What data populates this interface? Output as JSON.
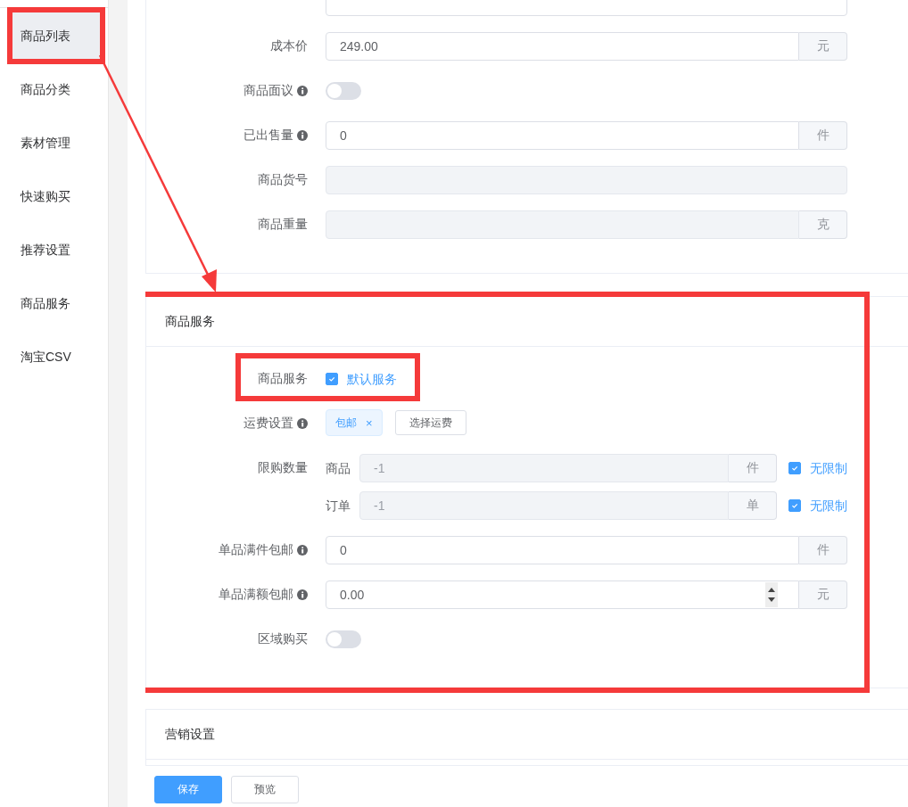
{
  "sidebar": {
    "items": [
      {
        "label": "商品列表",
        "selected": true,
        "highlighted": true
      },
      {
        "label": "商品分类",
        "selected": false,
        "highlighted": false
      },
      {
        "label": "素材管理",
        "selected": false,
        "highlighted": false
      },
      {
        "label": "快速购买",
        "selected": false,
        "highlighted": false
      },
      {
        "label": "推荐设置",
        "selected": false,
        "highlighted": false
      },
      {
        "label": "商品服务",
        "selected": false,
        "highlighted": false
      },
      {
        "label": "淘宝CSV",
        "selected": false,
        "highlighted": false
      }
    ]
  },
  "annotation_arrow": true,
  "basic_card": {
    "fields": [
      {
        "kind": "input"
      },
      {
        "kind": "input",
        "label": "成本价",
        "value": "249.00",
        "suffix": "元",
        "disabled": false
      },
      {
        "kind": "switch",
        "label": "商品面议",
        "info": true,
        "on": false
      },
      {
        "kind": "input",
        "label": "已出售量",
        "info": true,
        "value": "0",
        "suffix": "件",
        "disabled": false
      },
      {
        "kind": "input",
        "label": "商品货号",
        "disabled": true
      },
      {
        "kind": "input",
        "label": "商品重量",
        "suffix": "克",
        "disabled": true
      }
    ]
  },
  "service_card": {
    "title": "商品服务",
    "highlighted": true,
    "fields": [
      {
        "kind": "checkbox",
        "label": "商品服务",
        "option": "默认服务",
        "checked": true,
        "highlighted": true
      },
      {
        "kind": "tags",
        "label": "运费设置",
        "info": true,
        "tags": [
          {
            "label": "包邮",
            "close": "×"
          }
        ],
        "button": "选择运费"
      },
      {
        "kind": "limits",
        "label": "限购数量",
        "rows": [
          {
            "label": "商品",
            "placeholder": "-1",
            "suffix": "件",
            "disabled": true,
            "option": "无限制",
            "checked": true
          },
          {
            "label": "订单",
            "placeholder": "-1",
            "suffix": "单",
            "disabled": true,
            "option": "无限制",
            "checked": true
          }
        ]
      },
      {
        "kind": "input",
        "label": "单品满件包邮",
        "info": true,
        "value": "0",
        "suffix": "件",
        "disabled": false
      },
      {
        "kind": "number",
        "label": "单品满额包邮",
        "info": true,
        "value": "0.00",
        "suffix": "元",
        "disabled": false
      },
      {
        "kind": "switch",
        "label": "区域购买",
        "on": false
      }
    ]
  },
  "marketing_card": {
    "title": "营销设置"
  },
  "footer": {
    "buttons": [
      {
        "label": "保存",
        "kind": "primary"
      },
      {
        "label": "预览",
        "kind": "default"
      }
    ]
  }
}
